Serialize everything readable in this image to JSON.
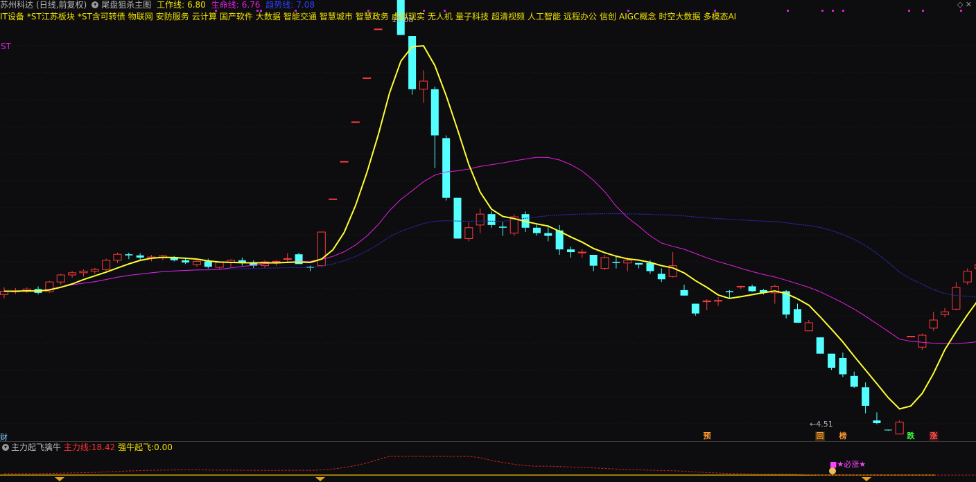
{
  "header": {
    "stock_name": "苏州科达",
    "period": "(日线,前复权)",
    "indicator_name": "尾盘狙杀主图",
    "work_line_label": "工作线:",
    "work_line_value": "6.80",
    "life_line_label": "生命线:",
    "life_line_value": "6.76",
    "trend_line_label": "趋势线:",
    "trend_line_value": "7.08"
  },
  "concepts": [
    "IT设备",
    "*ST江苏板块",
    "*ST含可转债",
    "物联网",
    "安防服务",
    "云计算",
    "国产软件",
    "大数据",
    "智能交通",
    "智慧城市",
    "智慧政务",
    "虚拟现实",
    "无人机",
    "量子科技",
    "超清视频",
    "人工智能",
    "远程办公",
    "信创",
    "AIGC概念",
    "时空大数据",
    "多模态AI"
  ],
  "labels": {
    "st": "ST",
    "high_price": "11.08",
    "low_price": "4.51",
    "cai": "财",
    "yu": "预",
    "hui": "回",
    "bang": "榜",
    "die": "跌",
    "zhang": "涨",
    "bizhang": "★必涨★"
  },
  "sub_panel": {
    "name": "主力起飞擒牛",
    "main_line_label": "主力线:",
    "main_line_value": "18.42",
    "bull_label": "强牛起飞:",
    "bull_value": "0.00"
  },
  "colors": {
    "up": "#ff3b3b",
    "down": "#54ffff",
    "work_line": "#ffff33",
    "life_line": "#e020e0",
    "trend_line": "#2a2aa8"
  },
  "candles": [
    [
      4.97,
      5.1,
      4.9,
      5.03
    ],
    [
      5.03,
      5.09,
      4.98,
      5.03
    ],
    [
      5.03,
      5.1,
      5.0,
      5.07
    ],
    [
      5.07,
      5.12,
      4.97,
      5.0
    ],
    [
      5.02,
      5.22,
      5.0,
      5.2
    ],
    [
      5.2,
      5.35,
      5.15,
      5.33
    ],
    [
      5.33,
      5.4,
      5.28,
      5.37
    ],
    [
      5.37,
      5.43,
      5.3,
      5.4
    ],
    [
      5.4,
      5.46,
      5.35,
      5.43
    ],
    [
      5.43,
      5.63,
      5.4,
      5.6
    ],
    [
      5.6,
      5.74,
      5.55,
      5.71
    ],
    [
      5.71,
      5.74,
      5.62,
      5.69
    ],
    [
      5.69,
      5.73,
      5.6,
      5.65
    ],
    [
      5.64,
      5.7,
      5.58,
      5.66
    ],
    [
      5.65,
      5.7,
      5.6,
      5.68
    ],
    [
      5.66,
      5.68,
      5.58,
      5.6
    ],
    [
      5.6,
      5.65,
      5.53,
      5.56
    ],
    [
      5.52,
      5.6,
      5.48,
      5.58
    ],
    [
      5.58,
      5.63,
      5.45,
      5.48
    ],
    [
      5.47,
      5.58,
      5.43,
      5.56
    ],
    [
      5.56,
      5.62,
      5.48,
      5.6
    ],
    [
      5.6,
      5.65,
      5.5,
      5.55
    ],
    [
      5.55,
      5.6,
      5.46,
      5.5
    ],
    [
      5.5,
      5.6,
      5.45,
      5.57
    ],
    [
      5.57,
      5.6,
      5.5,
      5.58
    ],
    [
      5.63,
      5.73,
      5.55,
      5.63
    ],
    [
      5.71,
      5.74,
      5.55,
      5.53
    ],
    [
      5.48,
      5.5,
      5.4,
      5.46
    ],
    [
      5.5,
      6.13,
      5.48,
      6.12
    ],
    [
      6.73,
      6.73,
      6.73,
      6.73
    ],
    [
      7.42,
      7.42,
      7.42,
      7.42
    ],
    [
      8.15,
      8.15,
      8.15,
      8.15
    ],
    [
      8.96,
      8.96,
      8.96,
      8.96
    ],
    [
      9.86,
      9.86,
      9.86,
      9.86
    ],
    [
      10.85,
      10.85,
      10.85,
      10.85
    ],
    [
      11.08,
      11.08,
      9.75,
      9.75
    ],
    [
      9.73,
      9.73,
      8.65,
      8.75
    ],
    [
      8.75,
      9.1,
      8.5,
      8.9
    ],
    [
      8.75,
      8.8,
      7.3,
      7.9
    ],
    [
      7.85,
      7.9,
      6.7,
      6.75
    ],
    [
      6.75,
      6.75,
      6.0,
      6.0
    ],
    [
      6.0,
      6.3,
      5.95,
      6.2
    ],
    [
      6.25,
      6.55,
      6.1,
      6.45
    ],
    [
      6.45,
      6.5,
      6.2,
      6.25
    ],
    [
      6.22,
      6.3,
      6.05,
      6.2
    ],
    [
      6.1,
      6.45,
      6.05,
      6.4
    ],
    [
      6.45,
      6.5,
      6.12,
      6.2
    ],
    [
      6.2,
      6.28,
      6.05,
      6.1
    ],
    [
      6.1,
      6.25,
      5.95,
      6.05
    ],
    [
      6.15,
      6.25,
      5.7,
      5.8
    ],
    [
      5.8,
      5.85,
      5.65,
      5.75
    ],
    [
      5.75,
      5.8,
      5.65,
      5.75
    ],
    [
      5.7,
      5.7,
      5.4,
      5.5
    ],
    [
      5.45,
      5.7,
      5.42,
      5.65
    ],
    [
      5.57,
      5.67,
      5.45,
      5.55
    ],
    [
      5.55,
      5.65,
      5.4,
      5.6
    ],
    [
      5.55,
      5.55,
      5.45,
      5.52
    ],
    [
      5.55,
      5.6,
      5.35,
      5.4
    ],
    [
      5.35,
      5.45,
      5.2,
      5.25
    ],
    [
      5.3,
      5.75,
      5.28,
      5.5
    ],
    [
      5.05,
      5.15,
      4.95,
      4.95
    ],
    [
      4.8,
      4.8,
      4.58,
      4.62
    ],
    [
      4.85,
      4.88,
      4.68,
      4.85
    ],
    [
      4.85,
      4.92,
      4.76,
      4.86
    ],
    [
      5.03,
      5.05,
      4.9,
      5.01
    ],
    [
      5.12,
      5.13,
      5.07,
      5.12
    ],
    [
      5.12,
      5.15,
      5.02,
      5.03
    ],
    [
      5.05,
      5.07,
      4.97,
      5.0
    ],
    [
      5.0,
      5.15,
      4.8,
      5.12
    ],
    [
      5.03,
      5.05,
      4.53,
      4.6
    ],
    [
      4.7,
      4.8,
      4.45,
      4.45
    ],
    [
      4.3,
      4.5,
      4.3,
      4.45
    ],
    [
      4.18,
      4.18,
      3.88,
      3.88
    ],
    [
      3.88,
      3.88,
      3.58,
      3.62
    ],
    [
      3.8,
      3.9,
      3.45,
      3.5
    ],
    [
      3.47,
      3.55,
      3.25,
      3.27
    ],
    [
      3.26,
      3.35,
      2.78,
      2.92
    ],
    [
      2.65,
      2.8,
      2.58,
      2.6
    ],
    [
      2.48,
      2.48,
      2.46,
      2.47
    ],
    [
      2.4,
      2.65,
      2.39,
      2.62
    ],
    [
      4.2,
      4.2,
      4.2,
      4.2
    ],
    [
      4.0,
      4.25,
      3.95,
      4.22
    ],
    [
      4.35,
      4.65,
      4.3,
      4.5
    ],
    [
      4.6,
      4.72,
      4.55,
      4.65
    ],
    [
      4.7,
      5.2,
      4.68,
      5.1
    ],
    [
      5.2,
      5.45,
      5.15,
      5.4
    ],
    [
      5.45,
      5.6,
      5.35,
      5.52
    ],
    [
      5.55,
      5.9,
      5.35,
      5.45
    ],
    [
      5.35,
      5.6,
      5.05,
      5.1
    ],
    [
      5.1,
      5.7,
      5.05,
      5.6
    ]
  ]
}
